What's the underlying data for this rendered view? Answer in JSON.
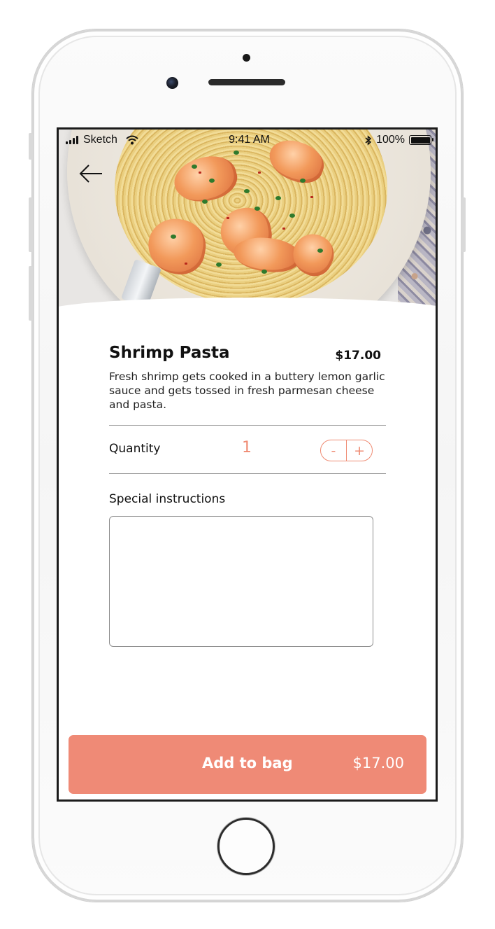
{
  "status_bar": {
    "carrier": "Sketch",
    "time": "9:41 AM",
    "battery": "100%"
  },
  "item": {
    "name": "Shrimp Pasta",
    "price": "$17.00",
    "description": "Fresh shrimp gets cooked in a buttery lemon garlic sauce and gets tossed in fresh parmesan cheese and pasta."
  },
  "quantity": {
    "label": "Quantity",
    "value": "1",
    "decrement_label": "-",
    "increment_label": "+"
  },
  "special_instructions": {
    "label": "Special instructions",
    "value": ""
  },
  "add_button": {
    "label": "Add to bag",
    "amount": "$17.00"
  },
  "icons": {
    "back": "arrow-left-icon",
    "signal": "cellular-signal-icon",
    "wifi": "wifi-icon",
    "bluetooth": "bluetooth-icon",
    "battery": "battery-icon"
  },
  "colors": {
    "accent": "#ef8a72",
    "button": "#ef8a76",
    "text": "#111111"
  }
}
